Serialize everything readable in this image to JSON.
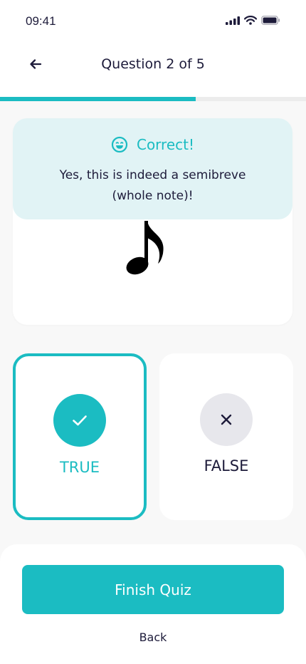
{
  "status_bar": {
    "time": "09:41"
  },
  "header": {
    "title": "Question 2 of 5"
  },
  "progress": {
    "current": 2,
    "total": 5,
    "fraction": 0.64
  },
  "feedback": {
    "title": "Correct!",
    "message": "Yes, this is indeed a semibreve (whole note)!",
    "icon": "smiley-icon"
  },
  "question": {
    "image_icon": "eighth-note-icon"
  },
  "answers": {
    "true": {
      "label": "TRUE",
      "icon": "checkmark-icon",
      "selected": true
    },
    "false": {
      "label": "FALSE",
      "icon": "x-icon",
      "selected": false
    }
  },
  "footer": {
    "primary_label": "Finish Quiz",
    "secondary_label": "Back"
  },
  "colors": {
    "accent": "#1bbcc2",
    "banner": "#e1f3f5",
    "text": "#1d1b3a",
    "muted_circle": "#e7e7ec"
  }
}
